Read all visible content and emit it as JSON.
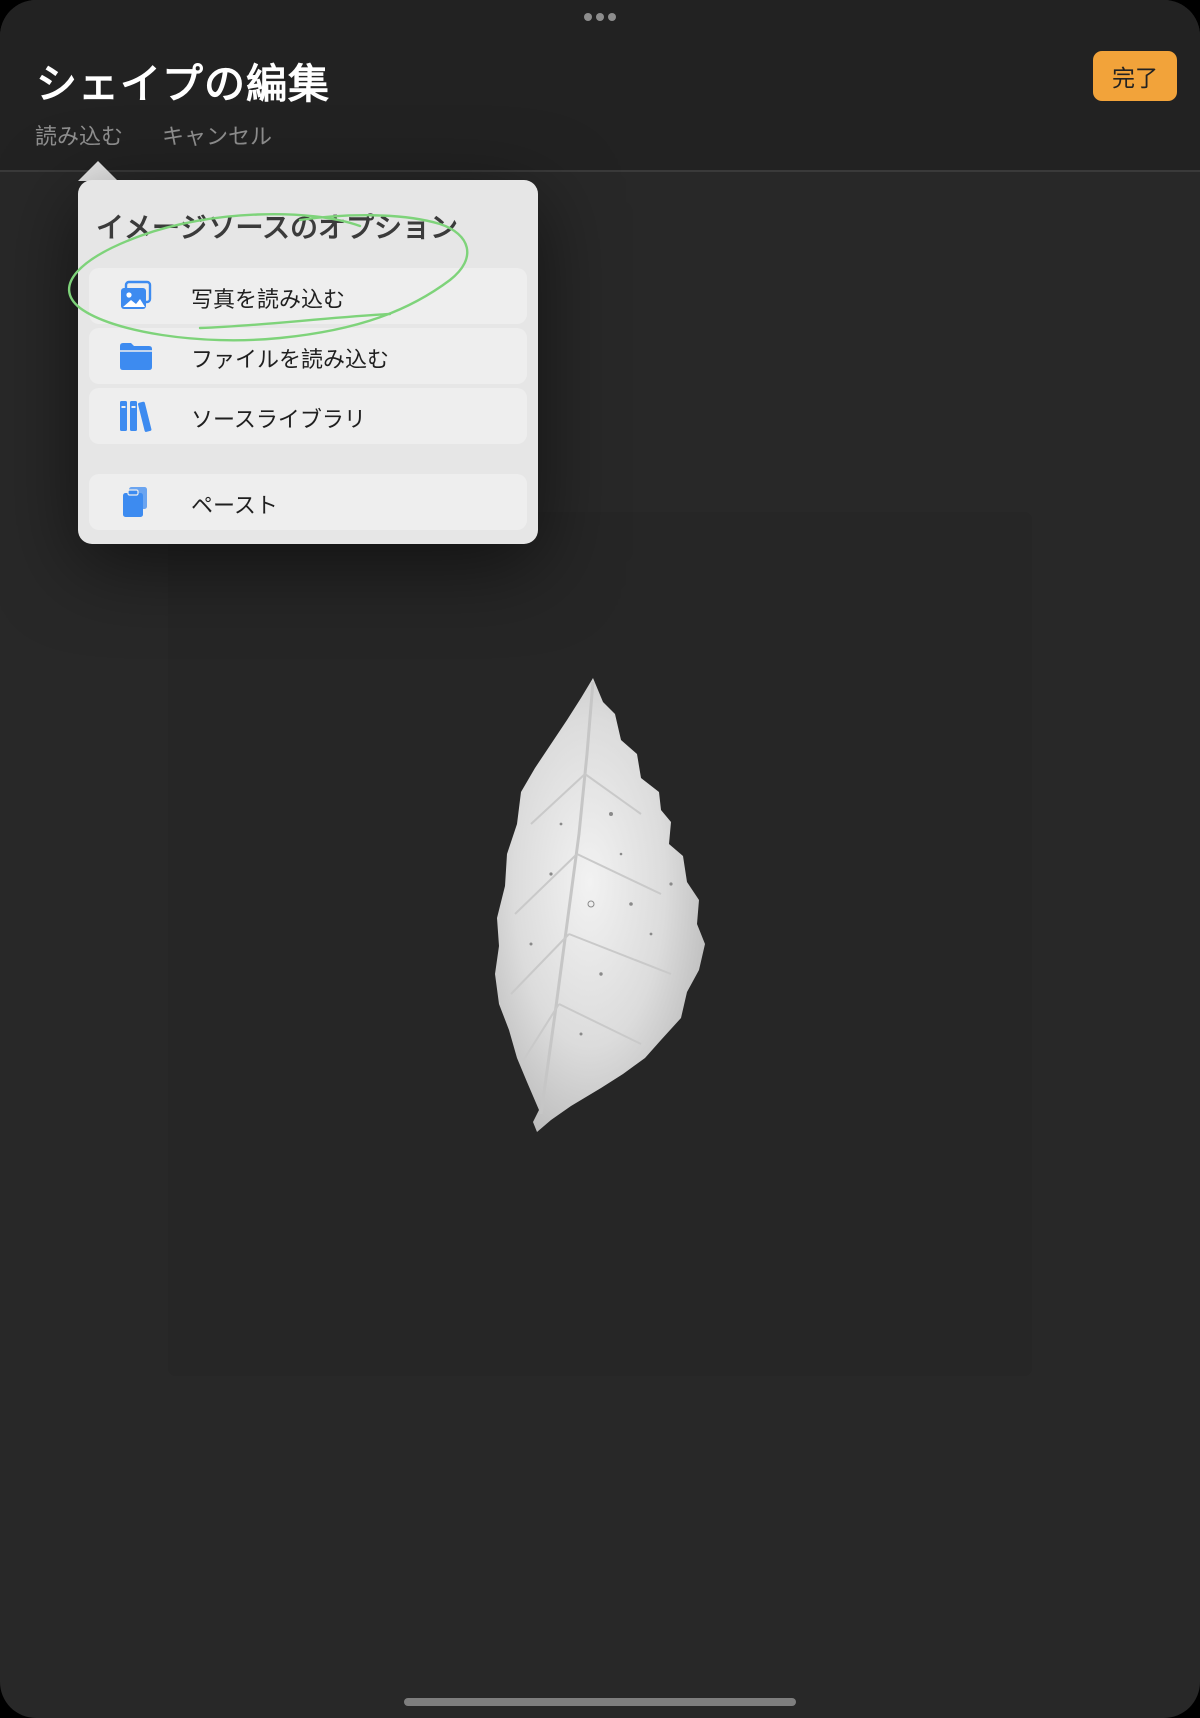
{
  "header": {
    "title": "シェイプの編集",
    "done_label": "完了",
    "import_label": "読み込む",
    "cancel_label": "キャンセル"
  },
  "popover": {
    "title": "イメージソースのオプション",
    "items": [
      {
        "label": "写真を読み込む",
        "icon": "photos-icon"
      },
      {
        "label": "ファイルを読み込む",
        "icon": "folder-icon"
      },
      {
        "label": "ソースライブラリ",
        "icon": "library-books-icon"
      },
      {
        "label": "ペースト",
        "icon": "clipboard-icon"
      }
    ]
  },
  "colors": {
    "accent_done": "#f2a33a",
    "icon_blue": "#3d8bf0",
    "annotation_green": "#7ed37a",
    "background": "#282828",
    "header_bg": "#222222",
    "popover_bg": "#e6e6e6"
  }
}
